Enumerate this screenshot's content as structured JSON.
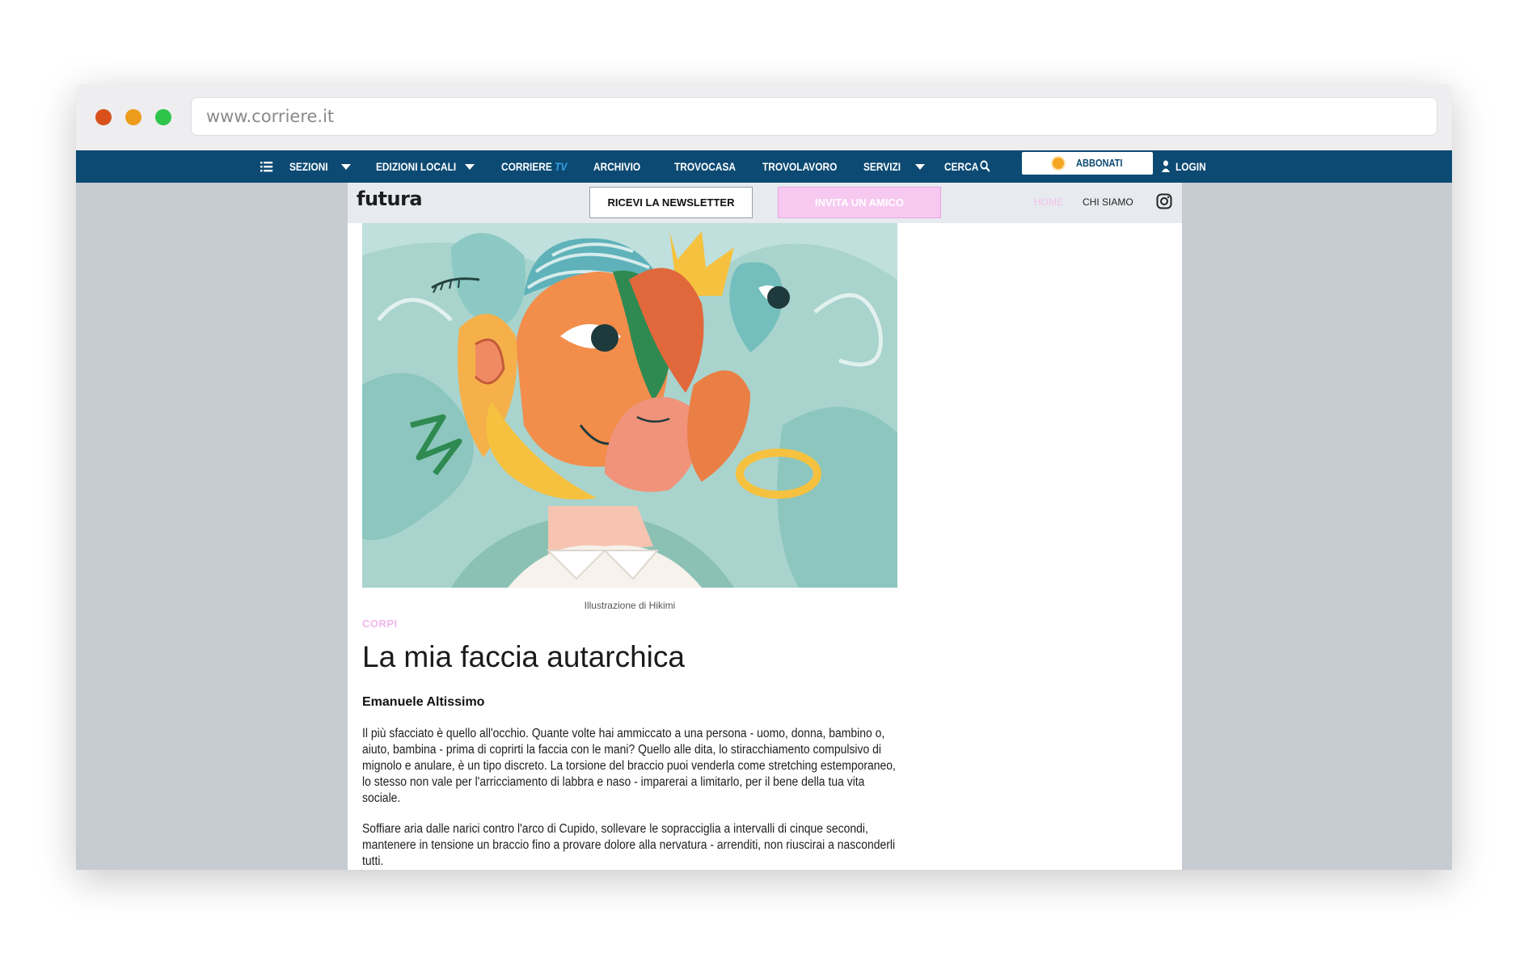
{
  "browser": {
    "url": "www.corriere.it"
  },
  "nav": {
    "sezioni": "SEZIONI",
    "edizioni_locali": "EDIZIONI LOCALI",
    "corriere": "CORRIERE",
    "tv": "TV",
    "archivio": "ARCHIVIO",
    "trovocasa": "TROVOCASA",
    "trovolavoro": "TROVOLAVORO",
    "servizi": "SERVIZI",
    "cerca": "CERCA",
    "abbonati": "ABBONATI",
    "login": "LOGIN"
  },
  "futura": {
    "logo": "futura",
    "newsletter_button": "RICEVI LA NEWSLETTER",
    "invite_button": "INVITA UN AMICO",
    "home": "HOME",
    "chi_siamo": "CHI SIAMO"
  },
  "article": {
    "caption": "Illustrazione di Hikimi",
    "kicker": "CORPI",
    "title": "La mia faccia autarchica",
    "author": "Emanuele Altissimo",
    "paragraph_1": "Il più sfacciato è quello all'occhio. Quante volte hai ammiccato a una persona - uomo, donna, bambino o, aiuto, bambina - prima di coprirti la faccia con le mani? Quello alle dita, lo stiracchiamento compulsivo di mignolo e anulare, è un tipo discreto. La torsione del braccio puoi venderla come stretching estemporaneo, lo stesso non vale per l'arricciamento di labbra e naso - imparerai a limitarlo, per il bene della tua vita sociale.",
    "paragraph_2": "Soffiare aria dalle narici contro l'arco di Cupido, sollevare le sopracciglia a intervalli di cinque secondi, mantenere in tensione un braccio fino a provare dolore alla nervatura - arrenditi, non riuscirai a nasconderli tutti."
  },
  "colors": {
    "nav_bg": "#0c4a73",
    "accent_pink": "#f7c9f1",
    "tv_blue": "#35a3e6"
  },
  "icons": [
    "menu-icon",
    "search-icon",
    "sun-icon",
    "user-icon",
    "instagram-icon"
  ]
}
